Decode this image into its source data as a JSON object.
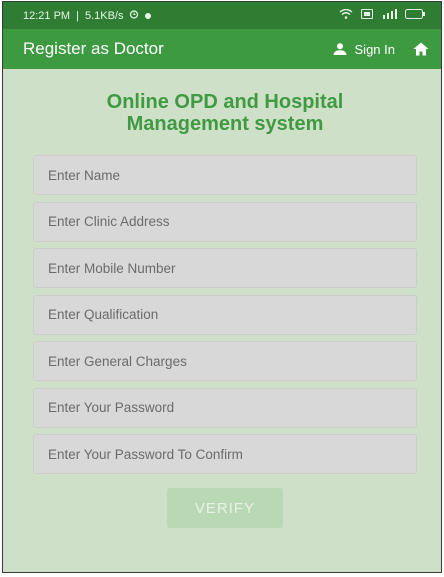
{
  "status_bar": {
    "time": "12:21 PM",
    "speed": "5.1KB/s",
    "icons": [
      "alarm-icon",
      "whatsapp-icon",
      "wifi-icon",
      "battery-saver-icon",
      "signal-icon",
      "battery-icon"
    ]
  },
  "app_bar": {
    "title": "Register as Doctor",
    "signin_label": "Sign In",
    "background": "#3d9a41"
  },
  "main": {
    "heading_line1": "Online OPD and Hospital",
    "heading_line2": "Management system",
    "fields": [
      "Enter Name",
      "Enter Clinic Address",
      "Enter Mobile Number",
      "Enter Qualification",
      "Enter General Charges",
      "Enter Your Password",
      "Enter Your Password To Confirm"
    ],
    "verify_label": "VERIFY",
    "accent_color": "#3f9a42",
    "background": "#cfe0c9"
  }
}
